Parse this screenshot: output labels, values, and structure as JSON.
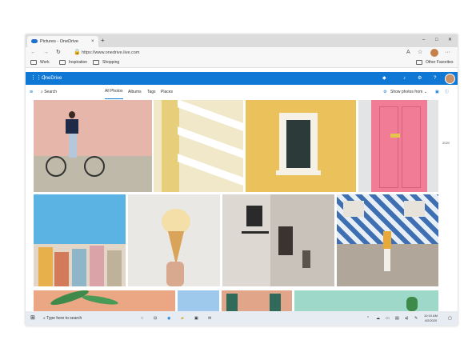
{
  "browser": {
    "tab_title": "Pictures - OneDrive",
    "tab_close": "×",
    "new_tab": "+",
    "minimize": "–",
    "maximize": "□",
    "close": "✕",
    "url": "https://www.onedrive.live.com",
    "more": "···"
  },
  "favorites": {
    "items": [
      "Work",
      "Inspiration",
      "Shopping"
    ],
    "other": "Other Favorites"
  },
  "onedrive": {
    "app_name": "OneDrive",
    "help": "?"
  },
  "commandbar": {
    "search_label": "Search",
    "tabs": [
      "All Photos",
      "Albums",
      "Tags",
      "Places"
    ],
    "show_photos_from": "Show photos from"
  },
  "photos": {
    "year_marker": "2020",
    "items": [
      {
        "subject": "man-with-bicycle"
      },
      {
        "subject": "yellow-balconies"
      },
      {
        "subject": "yellow-wall-window"
      },
      {
        "subject": "pink-door"
      },
      {
        "subject": "colorful-houses"
      },
      {
        "subject": "ice-cream-cone"
      },
      {
        "subject": "street-lamp"
      },
      {
        "subject": "woman-tiled-wall"
      },
      {
        "subject": "palm-leaves"
      },
      {
        "subject": "blue-sky"
      },
      {
        "subject": "shutter-building"
      },
      {
        "subject": "mint-wall-plant"
      }
    ]
  },
  "taskbar": {
    "search_placeholder": "Type here to search",
    "time": "10:10 AM",
    "date": "4/2/2020"
  },
  "colors": {
    "accent": "#0f78d4",
    "tabbar": "#dcdcdc",
    "taskbar": "#e7ecf3"
  }
}
